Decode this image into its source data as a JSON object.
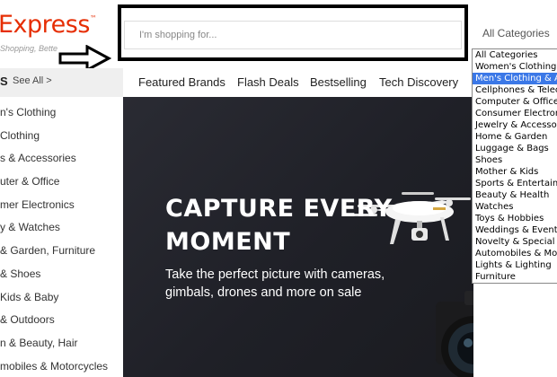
{
  "header": {
    "logo_text": "Express",
    "logo_mark": "™",
    "tagline": "Shopping, Bette",
    "search_placeholder": "I'm shopping for...",
    "category_select": "All Categories",
    "arrow_icon": "right-arrow-icon"
  },
  "category_dropdown": {
    "options": [
      "All Categories",
      "Women's Clothing &",
      "Men's Clothing & Acc",
      "Cellphones & Teleco",
      "Computer & Office",
      "Consumer Electronic",
      "Jewelry & Accessori",
      "Home & Garden",
      "Luggage & Bags",
      "Shoes",
      "Mother & Kids",
      "Sports & Entertainm",
      "Beauty & Health",
      "Watches",
      "Toys & Hobbies",
      "Weddings & Events",
      "Novelty & Special Us",
      "Automobiles & Moto",
      "Lights & Lighting",
      "Furniture"
    ],
    "selected": "Men's Clothing & Acc",
    "selected_color": "#3b78e7"
  },
  "nav": {
    "items": [
      "Featured Brands",
      "Flash Deals",
      "Bestselling",
      "Tech Discovery"
    ]
  },
  "sidebar": {
    "heading": "S",
    "see_all": "See All >",
    "items": [
      "n's Clothing",
      "Clothing",
      "s & Accessories",
      "uter & Office",
      "mer Electronics",
      "y & Watches",
      "& Garden, Furniture",
      "& Shoes",
      "Kids & Baby",
      "& Outdoors",
      "n & Beauty, Hair",
      "mobiles & Motorcycles"
    ]
  },
  "banner": {
    "title_line1": "CAPTURE EVERY",
    "title_line2": "MOMENT",
    "subtitle_line1": "Take the perfect picture with cameras,",
    "subtitle_line2": "gimbals, drones and more on sale",
    "drone_icon": "drone-icon",
    "camera_icon": "camera-icon"
  },
  "colors": {
    "brand": "#e62e04",
    "banner_bg": "#22232a",
    "nav_bg": "#efefef"
  }
}
